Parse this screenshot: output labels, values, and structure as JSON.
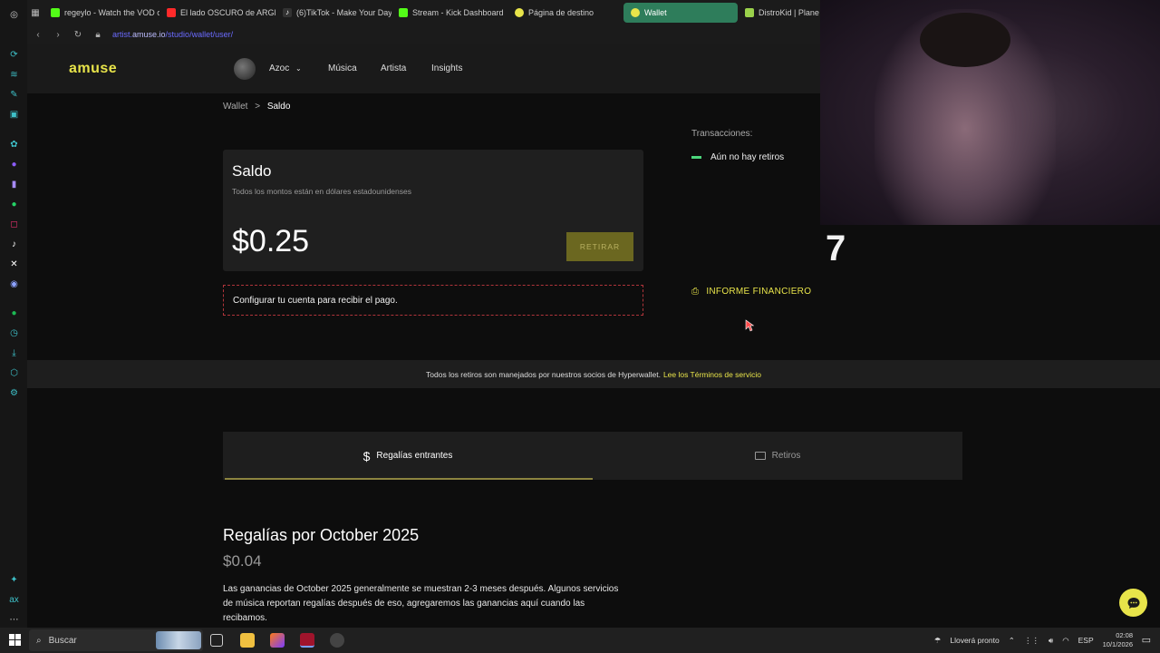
{
  "browser": {
    "tabs": [
      {
        "label": "regeylo - Watch the VOD o",
        "color": "#53fc18"
      },
      {
        "label": "El lado OSCURO de ARGE",
        "color": "#ff2a2a"
      },
      {
        "label": "(6)TikTok - Make Your Day",
        "color": "#ffffff"
      },
      {
        "label": "Stream - Kick Dashboard",
        "color": "#53fc18"
      },
      {
        "label": "Página de destino",
        "color": "#e8e44a"
      },
      {
        "label": "Wallet",
        "color": "#e8e44a",
        "active": true
      },
      {
        "label": "DistroKid | Plane",
        "color": "#9ad14b"
      }
    ],
    "url_prefix": "artist.",
    "url_domain": "amuse.io",
    "url_path": "/studio/wallet/user/"
  },
  "header": {
    "logo": "amuse",
    "user_name": "Azoc",
    "nav": [
      "Música",
      "Artista",
      "Insights"
    ]
  },
  "breadcrumb": {
    "root": "Wallet",
    "separator": ">",
    "current": "Saldo"
  },
  "balance": {
    "title": "Saldo",
    "subtitle": "Todos los montos están en dólares estadounidenses",
    "amount": "$0.25",
    "withdraw_label": "RETIRAR"
  },
  "setup_notice": "Configurar tu cuenta para recibir el pago.",
  "transactions": {
    "label": "Transacciones:",
    "empty": "Aún no hay retiros"
  },
  "report_link": "INFORME FINANCIERO",
  "hyperwallet": {
    "text": "Todos los retiros son manejados por nuestros socios de Hyperwallet.",
    "link": "Lee los Términos de servicio"
  },
  "tabs": {
    "incoming": "Regalías entrantes",
    "withdrawals": "Retiros"
  },
  "royalties": {
    "title": "Regalías por October 2025",
    "amount": "$0.04",
    "description": "Las ganancias de October 2025 generalmente se muestran 2-3 meses después. Algunos servicios de música reportan regalías después de eso, agregaremos las ganancias aquí cuando las recibamos."
  },
  "overlay": {
    "counter": "7"
  },
  "taskbar": {
    "search": "Buscar",
    "weather": "Lloverá pronto",
    "language": "ESP",
    "time": "02:08",
    "date": "10/1/2026"
  },
  "colors": {
    "accent": "#e8e44a",
    "success": "#4cd67c",
    "danger": "#b0343a"
  }
}
